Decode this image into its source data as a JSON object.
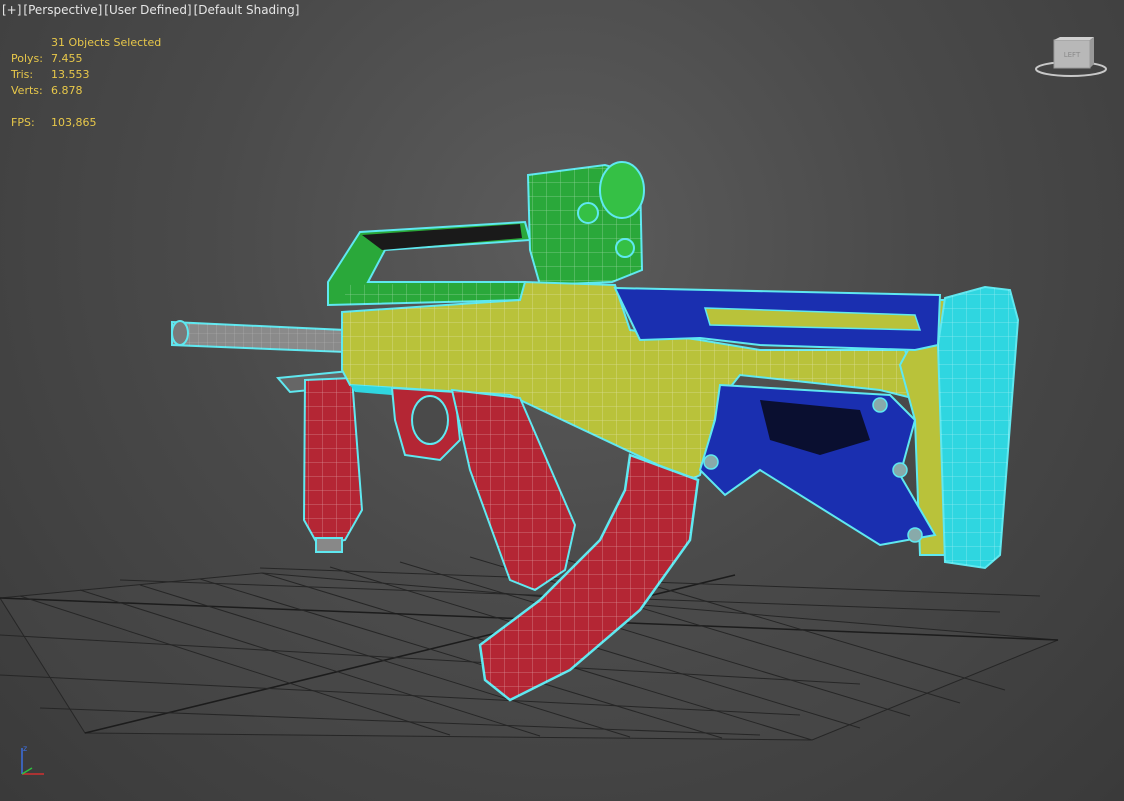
{
  "viewport": {
    "menu": "[+]",
    "view": "[Perspective]",
    "style": "[User Defined]",
    "shading": "[Default Shading]"
  },
  "stats": {
    "selected": "31 Objects Selected",
    "polys_label": "Polys:",
    "polys": "7.455",
    "tris_label": "Tris:",
    "tris": "13.553",
    "verts_label": "Verts:",
    "verts": "6.878",
    "fps_label": "FPS:",
    "fps": "103,865"
  },
  "viewcube": {
    "label": "LEFT"
  },
  "axis": {
    "z_label": "z"
  },
  "colors": {
    "background": "#4a4a4a",
    "grid": "#222222",
    "wire": "#5fe8f0",
    "yellow_part": "#b9c23a",
    "green_part": "#2aa83a",
    "blue_part": "#1a2fb0",
    "red_part": "#b42634",
    "cyan_part": "#2fd6e0",
    "stats_text": "#e8c84a"
  }
}
